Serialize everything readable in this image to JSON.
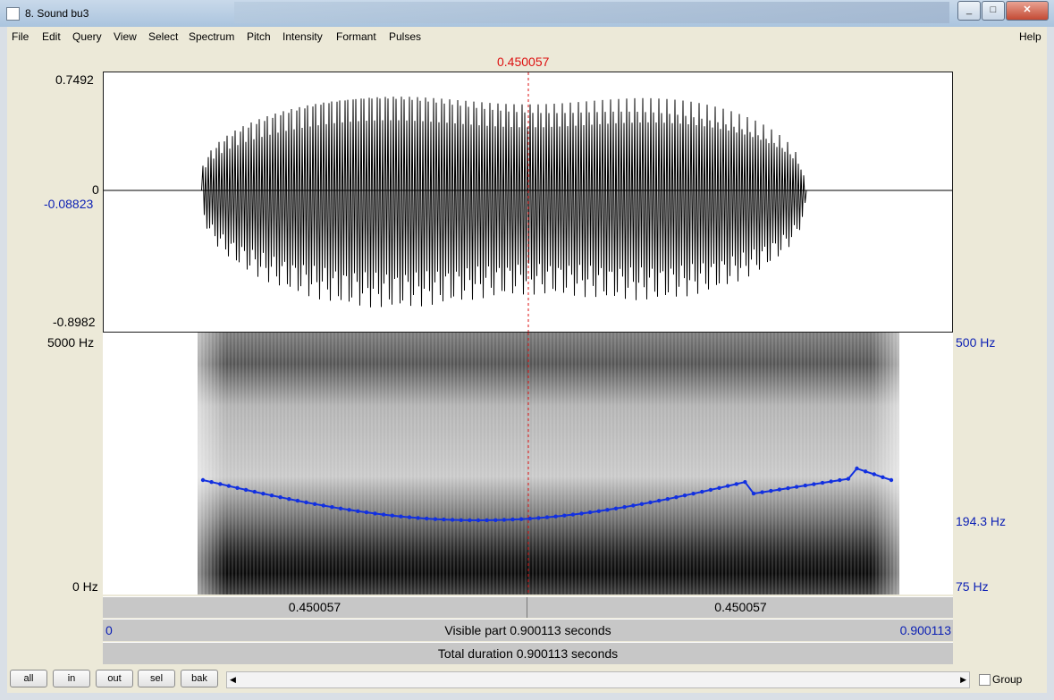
{
  "window": {
    "title": "8. Sound bu3"
  },
  "menu": {
    "items": [
      "File",
      "Edit",
      "Query",
      "View",
      "Select",
      "Spectrum",
      "Pitch",
      "Intensity",
      "Formant",
      "Pulses"
    ],
    "help": "Help"
  },
  "cursor": {
    "time_label": "0.450057"
  },
  "waveform": {
    "max_label": "0.7492",
    "zero_label": "0",
    "cursor_value_label": "-0.08823",
    "min_label": "-0.8982"
  },
  "spectrogram": {
    "top_label": "5000 Hz",
    "bottom_label": "0 Hz"
  },
  "pitch": {
    "top_label": "500 Hz",
    "cursor_label": "194.3 Hz",
    "bottom_label": "75 Hz"
  },
  "timebar": {
    "left_seg": "0.450057",
    "right_seg": "0.450057",
    "start": "0",
    "visible": "Visible part 0.900113 seconds",
    "end": "0.900113",
    "total": "Total duration 0.900113 seconds"
  },
  "buttons": {
    "all": "all",
    "in": "in",
    "out": "out",
    "sel": "sel",
    "bak": "bak"
  },
  "group": {
    "label": "Group"
  },
  "colors": {
    "pitch_line": "#1230e0",
    "cursor": "#d11",
    "axis_blue": "#0b1fb4"
  }
}
